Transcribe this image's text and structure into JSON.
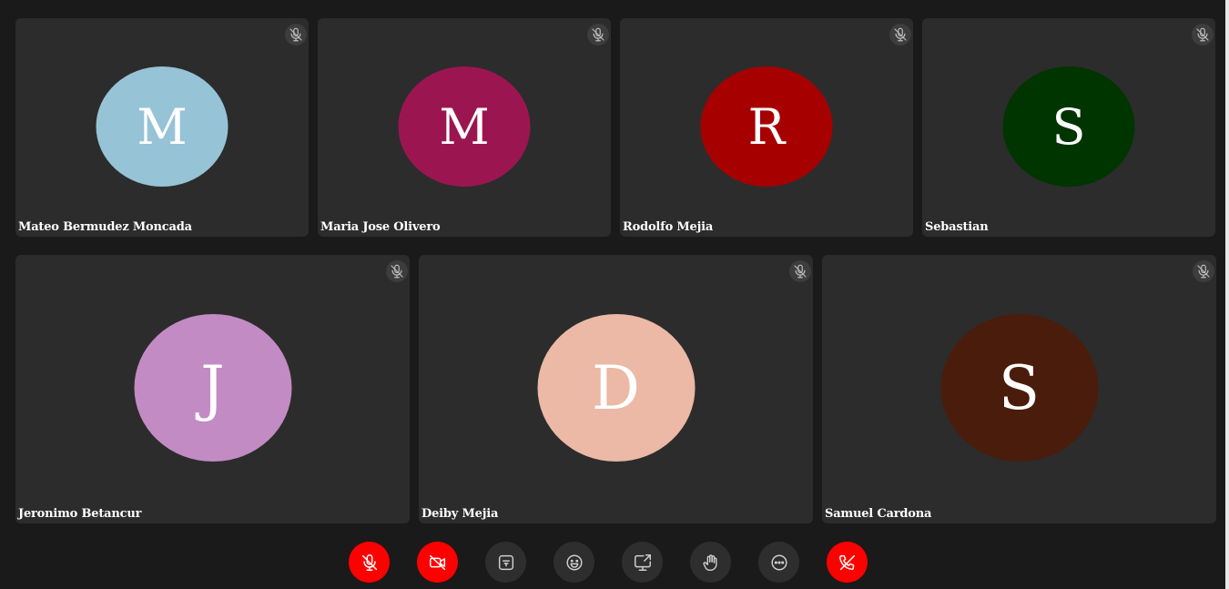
{
  "participants_top": [
    {
      "name": "Mateo Bermudez Moncada",
      "initial": "M",
      "color": "#96c3d6"
    },
    {
      "name": "Maria Jose Olivero",
      "initial": "M",
      "color": "#9b1650"
    },
    {
      "name": "Rodolfo Mejia",
      "initial": "R",
      "color": "#a60000"
    },
    {
      "name": "Sebastian",
      "initial": "S",
      "color": "#003500"
    }
  ],
  "participants_bottom": [
    {
      "name": "Jeronimo Betancur",
      "initial": "J",
      "color": "#c38bc3"
    },
    {
      "name": "Deiby Mejia",
      "initial": "D",
      "color": "#ebb9a5"
    },
    {
      "name": "Samuel Cardona",
      "initial": "S",
      "color": "#4a1c0b"
    }
  ],
  "participant_icon": "microphone-muted-icon",
  "toolbar": [
    {
      "name": "mute-mic-button",
      "icon": "microphone-muted-icon",
      "danger": true
    },
    {
      "name": "camera-off-button",
      "icon": "camera-off-icon",
      "danger": true
    },
    {
      "name": "chat-button",
      "icon": "chat-icon",
      "danger": false
    },
    {
      "name": "reactions-button",
      "icon": "smiley-icon",
      "danger": false
    },
    {
      "name": "share-screen-button",
      "icon": "screen-share-icon",
      "danger": false
    },
    {
      "name": "raise-hand-button",
      "icon": "hand-icon",
      "danger": false
    },
    {
      "name": "more-options-button",
      "icon": "more-horizontal-icon",
      "danger": false
    },
    {
      "name": "leave-call-button",
      "icon": "phone-hangup-icon",
      "danger": true
    }
  ],
  "colors": {
    "background": "#1a1a1a",
    "tile": "#2c2c2c",
    "danger": "#ff0000",
    "button": "#2e2e2e"
  }
}
